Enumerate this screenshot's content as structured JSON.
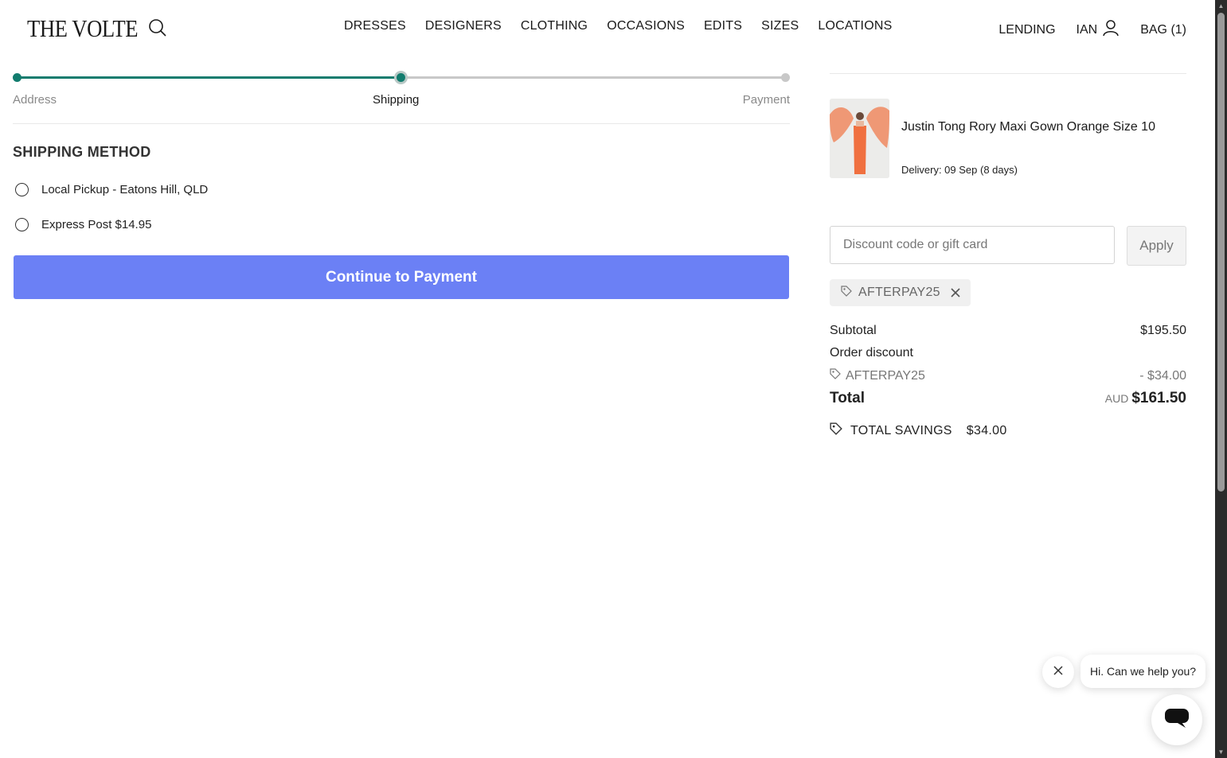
{
  "header": {
    "logo": "THE VOLTE",
    "nav": [
      "DRESSES",
      "DESIGNERS",
      "CLOTHING",
      "OCCASIONS",
      "EDITS",
      "SIZES",
      "LOCATIONS"
    ],
    "lending": "LENDING",
    "user": "IAN",
    "bag": "BAG (1)"
  },
  "progress": {
    "steps": [
      "Address",
      "Shipping",
      "Payment"
    ],
    "current_step": "Shipping"
  },
  "shipping": {
    "title": "SHIPPING METHOD",
    "options": [
      "Local Pickup - Eatons Hill, QLD",
      "Express Post $14.95"
    ],
    "continue_label": "Continue to Payment"
  },
  "summary": {
    "product_name": "Justin Tong Rory Maxi Gown Orange Size 10",
    "delivery": "Delivery: 09 Sep (8 days)",
    "discount_placeholder": "Discount code or gift card",
    "apply_label": "Apply",
    "applied_code": "AFTERPAY25",
    "subtotal_label": "Subtotal",
    "subtotal_value": "$195.50",
    "order_discount_label": "Order discount",
    "discount_code": "AFTERPAY25",
    "discount_value": "- $34.00",
    "total_label": "Total",
    "currency": "AUD",
    "total_value": "$161.50",
    "savings_label": "TOTAL SAVINGS",
    "savings_value": "$34.00"
  },
  "chat": {
    "greeting": "Hi. Can we help you?"
  },
  "colors": {
    "accent": "#127c6e",
    "button": "#6b80f5"
  }
}
